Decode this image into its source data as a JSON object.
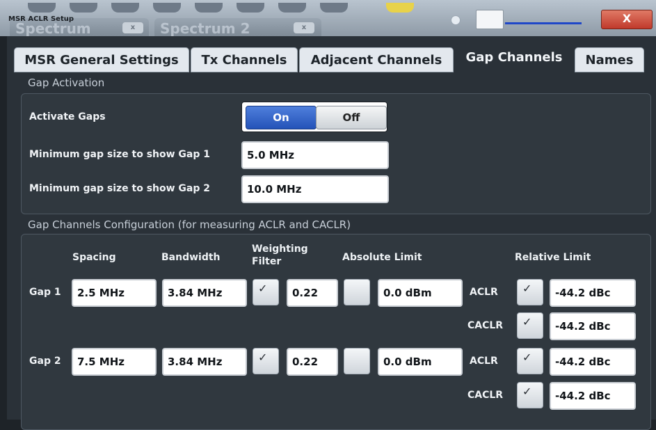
{
  "window": {
    "title": "MSR ACLR Setup",
    "close_label": "X"
  },
  "background_tabs": [
    {
      "label": "Spectrum",
      "close": "x"
    },
    {
      "label": "Spectrum 2",
      "close": "x"
    }
  ],
  "tabs": [
    {
      "label": "MSR General Settings"
    },
    {
      "label": "Tx Channels"
    },
    {
      "label": "Adjacent Channels"
    },
    {
      "label": "Gap Channels",
      "active": true
    },
    {
      "label": "Names"
    }
  ],
  "gap_activation": {
    "group_label": "Gap Activation",
    "activate_label": "Activate Gaps",
    "on_label": "On",
    "off_label": "Off",
    "selected": "On",
    "min_gap1_label": "Minimum gap size to show Gap 1",
    "min_gap1_value": "5.0 MHz",
    "min_gap2_label": "Minimum gap size to show Gap 2",
    "min_gap2_value": "10.0 MHz"
  },
  "gap_config": {
    "group_label": "Gap Channels Configuration (for measuring ACLR and CACLR)",
    "headers": {
      "spacing": "Spacing",
      "bandwidth": "Bandwidth",
      "weighting_filter": "Weighting\nFilter",
      "weighting_line1": "Weighting",
      "weighting_line2": "Filter",
      "absolute_limit": "Absolute Limit",
      "relative_limit": "Relative Limit"
    },
    "gaps": [
      {
        "label": "Gap 1",
        "spacing": "2.5 MHz",
        "bandwidth": "3.84 MHz",
        "weighting_checked": true,
        "weighting_value": "0.22",
        "absolute_checked": false,
        "absolute_value": "0.0 dBm",
        "aclr_label": "ACLR",
        "aclr_checked": true,
        "aclr_value": "-44.2 dBc",
        "caclr_label": "CACLR",
        "caclr_checked": true,
        "caclr_value": "-44.2 dBc"
      },
      {
        "label": "Gap 2",
        "spacing": "7.5 MHz",
        "bandwidth": "3.84 MHz",
        "weighting_checked": true,
        "weighting_value": "0.22",
        "absolute_checked": false,
        "absolute_value": "0.0 dBm",
        "aclr_label": "ACLR",
        "aclr_checked": true,
        "aclr_value": "-44.2 dBc",
        "caclr_label": "CACLR",
        "caclr_checked": true,
        "caclr_value": "-44.2 dBc"
      }
    ]
  },
  "colors": {
    "accent": "#2453b8",
    "close": "#c0392b",
    "panel": "#2a3138"
  }
}
